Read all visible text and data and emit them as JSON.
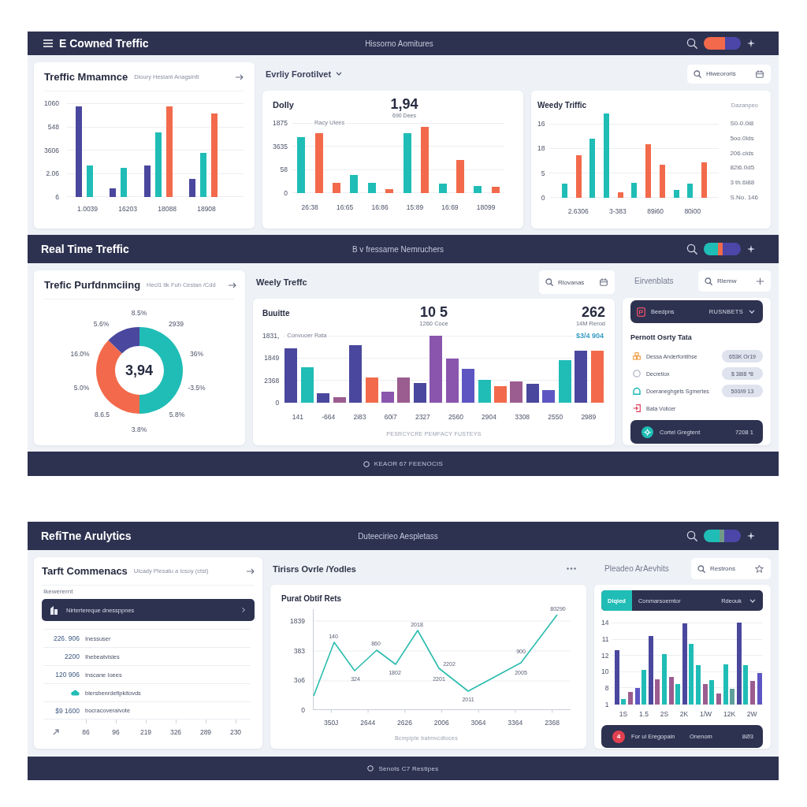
{
  "top_dashboard": {
    "header": {
      "title": "E Cowned Treffic",
      "center_text": "Hissorno Aomitures"
    },
    "summary_card": {
      "title": "Treffic Mmamnce",
      "subtitle": "Dioury Hesiant Anagsintt",
      "y_labels": [
        "1060",
        "548",
        "3606",
        "2.06",
        "6"
      ],
      "x_labels": [
        "1.0039",
        "16203",
        "18088",
        "18908"
      ]
    },
    "toolbar": {
      "heading": "Evrliy Forotilvet",
      "search_placeholder": "Hiweororis"
    },
    "daily_card": {
      "title": "Dolly",
      "value": "1,94",
      "value_caption": "690 Dees",
      "legend": "Racy Ulees",
      "y_labels": [
        "1875",
        "3635",
        "58",
        "0"
      ],
      "x_labels": [
        "26:38",
        "16:65",
        "16:86",
        "15:89",
        "16:69",
        "18099"
      ]
    },
    "weekly_card": {
      "title": "Weedy Triffic",
      "note": "Dazanpeo",
      "y_labels": [
        "16",
        "18",
        "5",
        "0"
      ],
      "x_labels": [
        "2.6306",
        "3-383",
        "89i60",
        "80i00"
      ],
      "side_values": [
        "S0-0.0i8",
        "5oo.0lds",
        "206.cids",
        "82i6.0d5",
        "3 th.6i88",
        "S.No. 146"
      ]
    }
  },
  "middle_dashboard": {
    "header": {
      "title": "Real Time Treffic",
      "center_text": "B v fressarne Nemruchers"
    },
    "donut_card": {
      "title": "Trefic Purfdnmciing",
      "subtitle": "Hecl1 tik Fuh Cestan /Cdd",
      "center_value": "3,94",
      "labels": [
        "8.5%",
        "5.6%",
        "2939",
        "16.0%",
        "36%",
        "5.0%",
        "-3.5%",
        "8.6.5",
        "5.8%",
        "3.8%"
      ]
    },
    "toolbar": {
      "heading": "Weely Treffc",
      "search_placeholder": "Rlovanas"
    },
    "bar_card": {
      "title": "Buuitte",
      "metrics": [
        {
          "value": "10 5",
          "caption": "1260 Coce"
        },
        {
          "value": "262",
          "caption": "14M Rerod",
          "highlight": "$3/4 904"
        }
      ],
      "legend": "Convuoer Rata",
      "y_labels": [
        "1831,",
        "1849",
        "2368",
        "0"
      ],
      "x_labels": [
        "141",
        "-664",
        "2i83",
        "60i7",
        "2327",
        "2560",
        "2904",
        "3308",
        "2550",
        "2989"
      ],
      "caption": "PESRCYCRE PEMFACY FUSTEYS"
    },
    "side_toolbar": {
      "heading": "Eirvenblats",
      "search_placeholder": "Rlemw"
    },
    "side_card": {
      "dropdown": {
        "label": "Beedpns",
        "value": "RUSNBETS"
      },
      "heading": "Pernott Osrty Tata",
      "items": [
        {
          "label": "Dessa Anderfontihse",
          "color": "#f0a04b",
          "badge": "653K Or19"
        },
        {
          "label": "Decretiox",
          "color": "#b4b9c6",
          "badge": "$ 38I8 *8"
        },
        {
          "label": "Doeraneghgets Sgmertes",
          "color": "#1bb8b0",
          "badge": "500/i9 13"
        },
        {
          "label": "Bata Volicer",
          "color": "#e0405a"
        }
      ],
      "summary": {
        "label": "Cortel Gregtent",
        "value": "7208 1"
      }
    },
    "footer": {
      "text": "KEAOR 67 FEENOCIS"
    }
  },
  "bottom_dashboard": {
    "header": {
      "title": "RefiTne Arulytics",
      "center_text": "Duteecirieo Aespletass"
    },
    "list_card": {
      "title": "Tarft Commenacs",
      "subtitle": "Ulcady Plesatu a Icsoy (ctst)",
      "section_label": "Ikewerernt",
      "dropdown": {
        "value": "Nirtertereque dnessppnes"
      },
      "rows": [
        {
          "kind": "number",
          "value": "226. 906",
          "label": "Inessuser"
        },
        {
          "kind": "number",
          "value": "2200",
          "label": "Ihebeatvisies"
        },
        {
          "kind": "number",
          "value": "120 906",
          "label": "Inscane Ioees"
        },
        {
          "kind": "icon",
          "label": "biersbenrdefipkitovds"
        },
        {
          "kind": "number",
          "value": "$9 1600",
          "label": "bocracoveraivote"
        }
      ],
      "x_labels": [
        "86",
        "96",
        "219",
        "326",
        "289",
        "230"
      ]
    },
    "toolbar": {
      "heading": "Tirisrs Ovrle /Yodles"
    },
    "line_card": {
      "title": "Purat Obtif Rets",
      "y_labels": [
        "1839",
        "383",
        "3o6",
        "0"
      ],
      "x_labels": [
        "350J",
        "2644",
        "2626",
        "2006",
        "3064",
        "3364",
        "2368"
      ],
      "point_labels": [
        "140",
        "324",
        "860",
        "1802",
        "2018",
        "2202",
        "2201",
        "2011",
        "900",
        "2005",
        "80290"
      ],
      "caption": "Bcmpiple batmvcdtoces"
    },
    "side_toolbar": {
      "heading": "Pleadeo ArAevhits",
      "search_placeholder": "Restrons"
    },
    "side_card": {
      "tabs": [
        {
          "label": "Diqied",
          "selected": true
        },
        {
          "label": "Conmarsoemtor",
          "selected": false
        }
      ],
      "dropdown": {
        "value": "Rdeouk"
      },
      "y_labels": [
        "14",
        "11",
        "12",
        "10",
        "8",
        "1"
      ],
      "x_labels": [
        "1S",
        "1.5",
        "2S",
        "2K",
        "1/W",
        "12K",
        "2W"
      ],
      "summary": {
        "badge": "4",
        "label": "For ul Eregopain",
        "status": "Onenom",
        "value": "8Ø3"
      }
    },
    "footer": {
      "text": "Senots C7 Restipes"
    }
  }
}
